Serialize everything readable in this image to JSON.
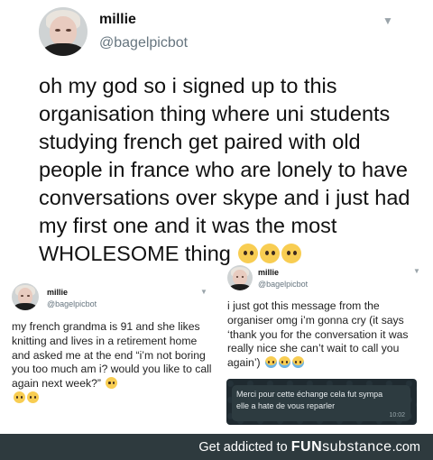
{
  "main_tweet": {
    "name": "millie",
    "handle": "@bagelpicbot",
    "text": "oh my god so i signed up to this organisation thing where uni students studying french get paired with old people in france who are lonely to have conversations over skype and i just had my first one and it was the most WHOLESOME thing",
    "emoji": "pleading-face-emoji"
  },
  "left_tweet": {
    "name": "millie",
    "handle": "@bagelpicbot",
    "text": "my french grandma is 91 and she likes knitting and lives in a retirement home and asked me at the end “i’m not boring you too much am i? would you like to call again next week?”"
  },
  "right_tweet": {
    "name": "millie",
    "handle": "@bagelpicbot",
    "text": "i just got this message from the organiser omg i’m gonna cry (it says ‘thank you for the conversation it was really nice she can’t wait to call you again’)"
  },
  "message_screenshot": {
    "text": "Merci pour cette échange cela fut sympa elle a hate de vous reparler",
    "time": "10:02"
  },
  "footer": {
    "prefix": "Get addicted to ",
    "brand_fun": "FUN",
    "brand_rest": "substance",
    "brand_tld": ".com"
  },
  "colors": {
    "handle": "#66757f",
    "footer_bg": "#2e3a3e",
    "emoji": "#f8cd52"
  }
}
